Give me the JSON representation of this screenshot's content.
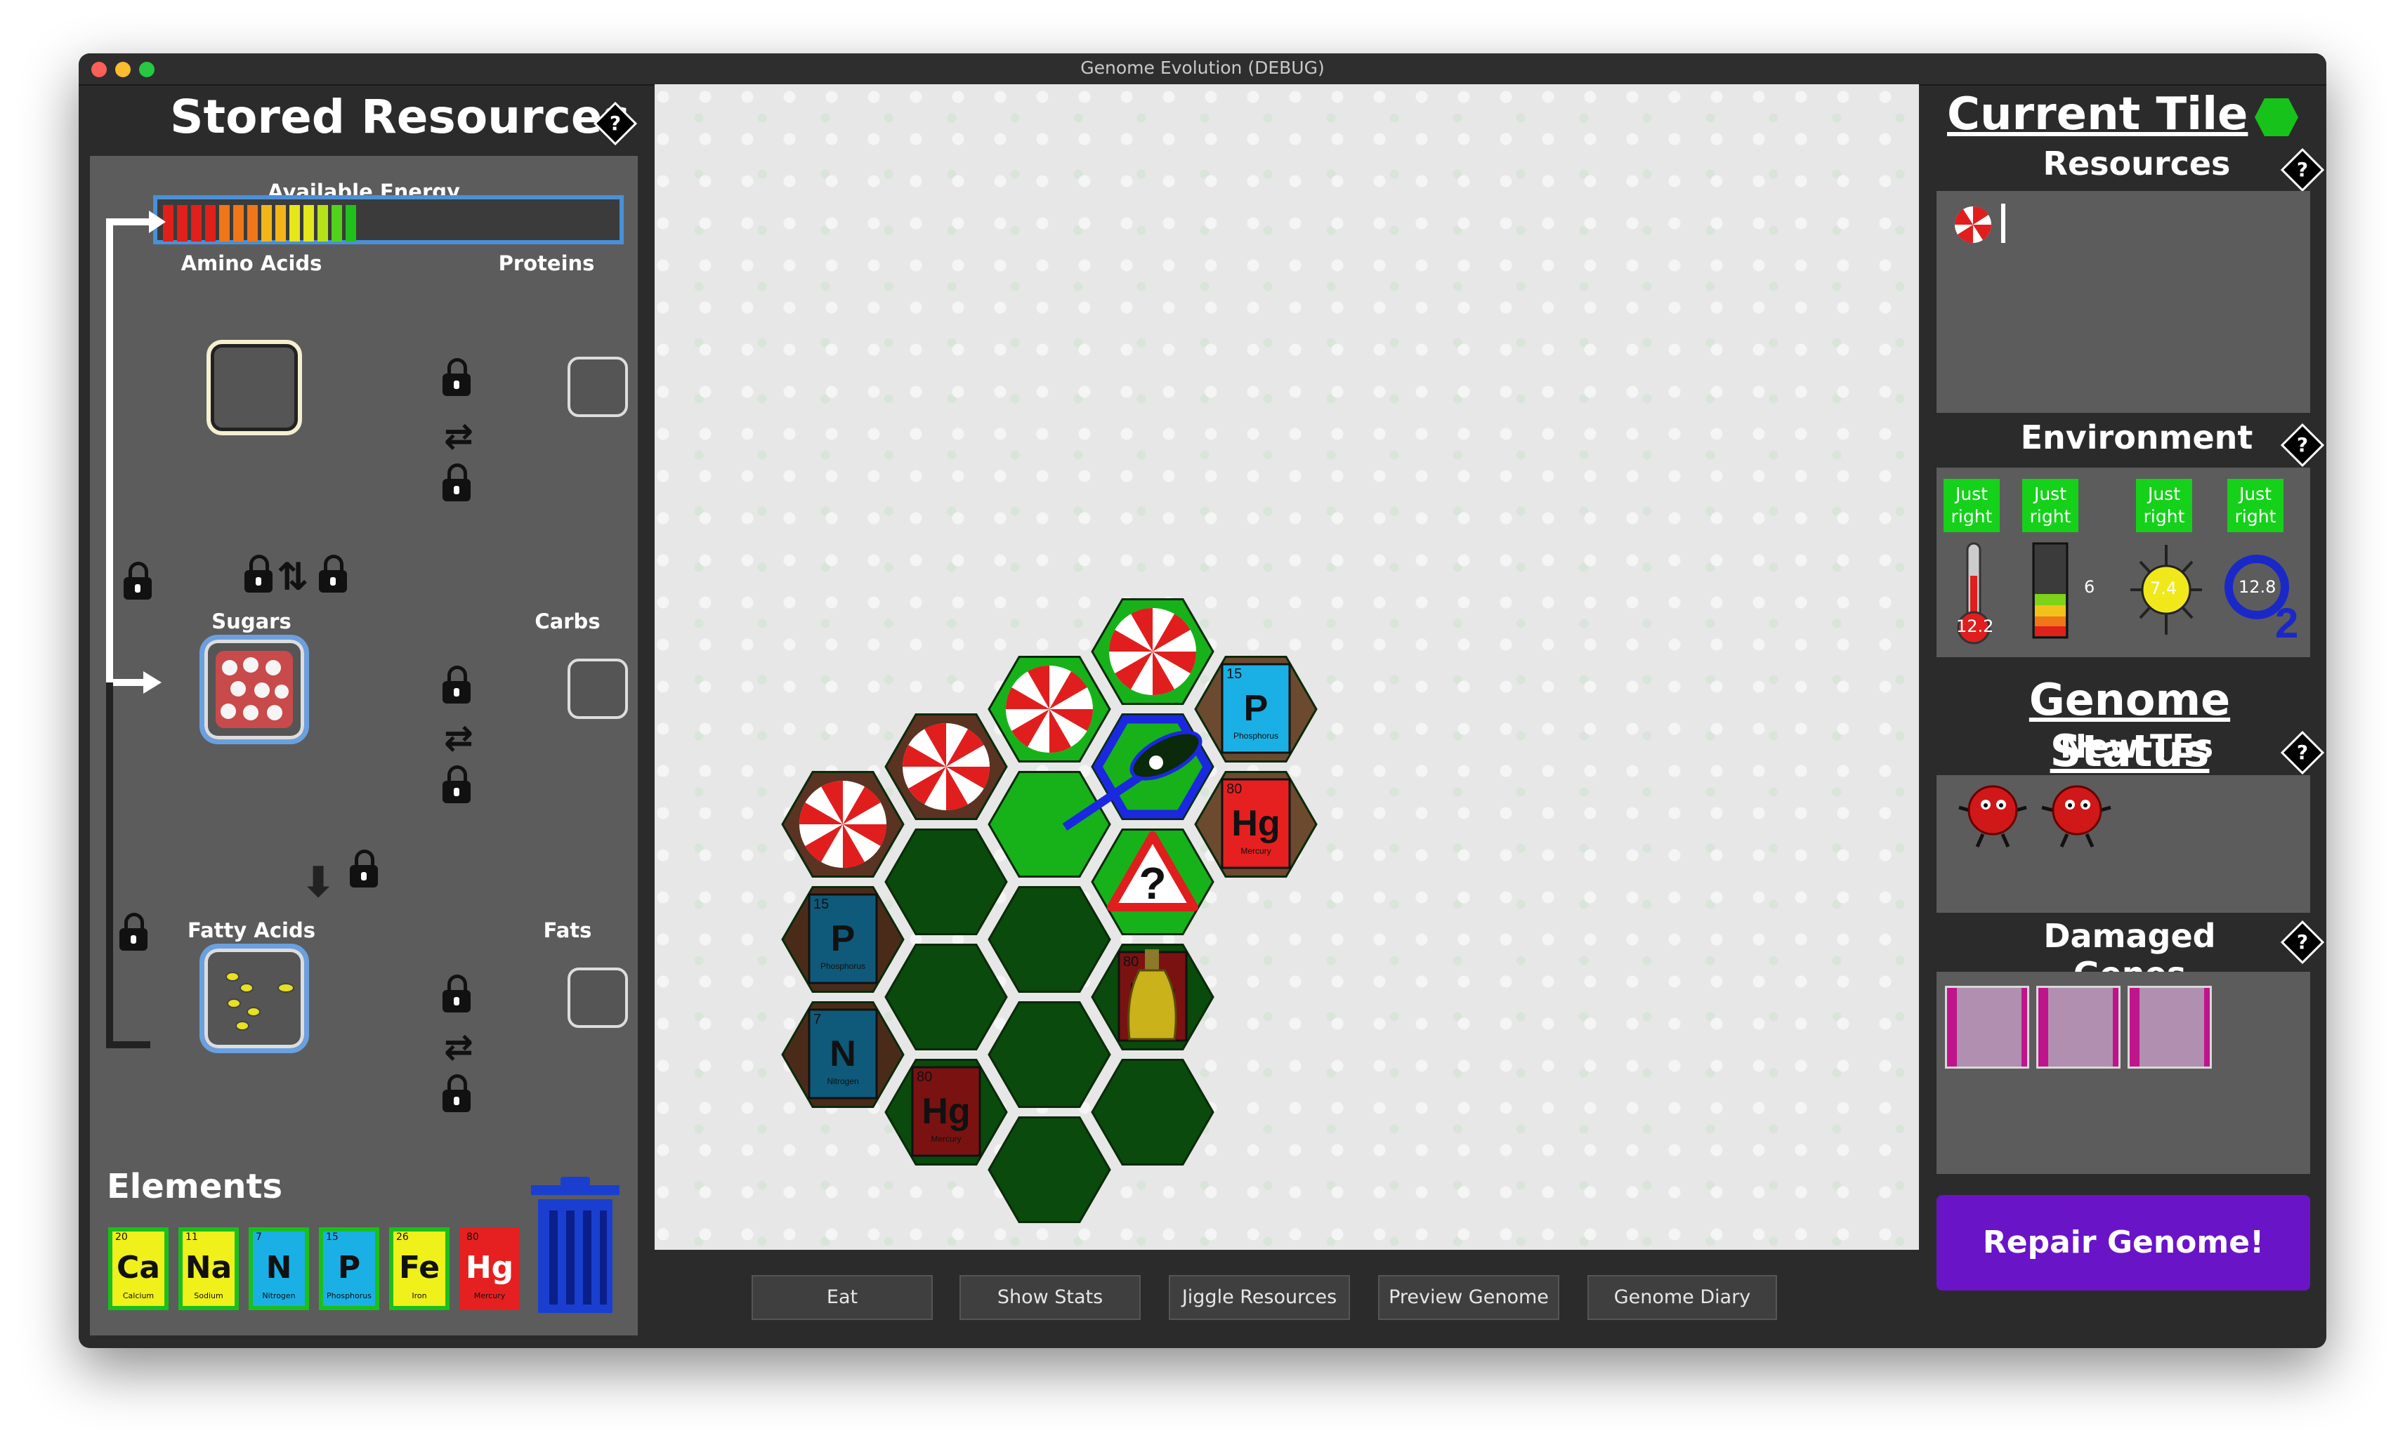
{
  "window": {
    "title": "Genome Evolution (DEBUG)"
  },
  "left_panel": {
    "heading": "Stored Resources",
    "help_glyph": "?",
    "energy_label": "Available Energy",
    "energy_segments": [
      "#e0201a",
      "#e0201a",
      "#e0201a",
      "#e0201a",
      "#f0761a",
      "#f0761a",
      "#f0761a",
      "#f2b61a",
      "#f2b61a",
      "#e6e61a",
      "#e6e61a",
      "#b6e21a",
      "#52d21a",
      "#1ec21a"
    ],
    "rows": [
      {
        "source": "Amino Acids",
        "product": "Proteins"
      },
      {
        "source": "Sugars",
        "product": "Carbs"
      },
      {
        "source": "Fatty Acids",
        "product": "Fats"
      }
    ],
    "elements_heading": "Elements",
    "elements": [
      {
        "num": "20",
        "sym": "Ca",
        "name": "Calcium",
        "color": "#f0f01a"
      },
      {
        "num": "11",
        "sym": "Na",
        "name": "Sodium",
        "color": "#f0f01a"
      },
      {
        "num": "7",
        "sym": "N",
        "name": "Nitrogen",
        "color": "#1ab0e6"
      },
      {
        "num": "15",
        "sym": "P",
        "name": "Phosphorus",
        "color": "#1ab0e6"
      },
      {
        "num": "26",
        "sym": "Fe",
        "name": "Iron",
        "color": "#f0f01a"
      },
      {
        "num": "80",
        "sym": "Hg",
        "name": "Mercury",
        "color": "#e62020"
      }
    ],
    "trash_icon": "trash-can-icon"
  },
  "board": {
    "tile_labels": [
      {
        "num": "15",
        "sym": "P",
        "name": "Phosphorus"
      },
      {
        "num": "80",
        "sym": "Hg",
        "name": "Mercury"
      },
      {
        "num": "15",
        "sym": "P",
        "name": "Phosphorus"
      },
      {
        "num": "80",
        "sym": "Hg",
        "name": "Mercury"
      },
      {
        "num": "7",
        "sym": "N",
        "name": "Nitrogen"
      },
      {
        "num": "80",
        "sym": "Hg",
        "name": "Mercury"
      }
    ],
    "unknown_glyph": "?"
  },
  "bottom_buttons": [
    "Eat",
    "Show Stats",
    "Jiggle Resources",
    "Preview Genome",
    "Genome Diary"
  ],
  "right_panel": {
    "current_tile": "Current Tile",
    "resources": "Resources",
    "environment": "Environment",
    "env_status": [
      {
        "line1": "Just",
        "line2": "right"
      },
      {
        "line1": "Just",
        "line2": "right"
      },
      {
        "line1": "Just",
        "line2": "right"
      },
      {
        "line1": "Just",
        "line2": "right"
      }
    ],
    "temperature": "12.2",
    "water_level": "6",
    "light": "7.4",
    "oxygen": "12.8",
    "genome_status": "Genome Status",
    "new_tes": "New TEs",
    "damaged_genes": "Damaged Genes",
    "repair": "Repair Genome!",
    "accent_color": "#6a14c8"
  }
}
